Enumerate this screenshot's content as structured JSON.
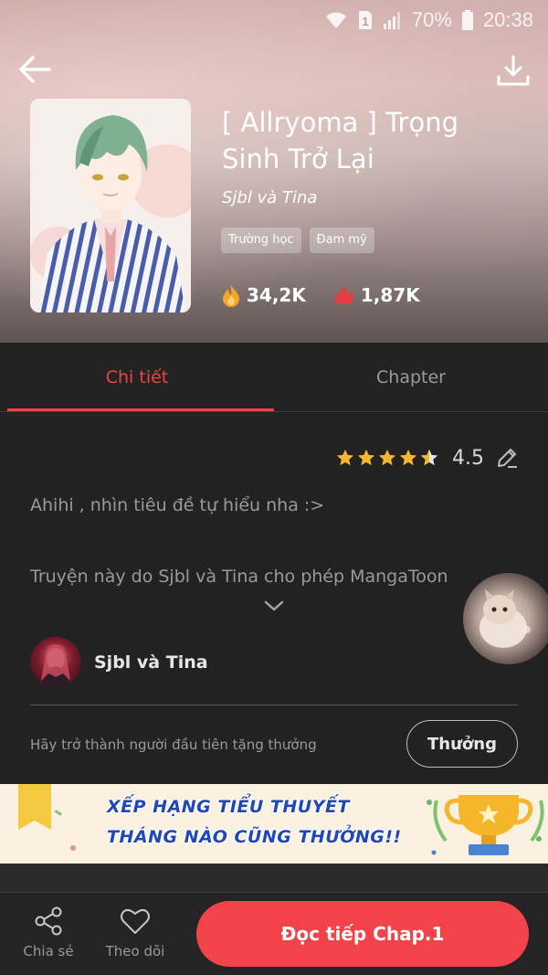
{
  "statusbar": {
    "battery": "70%",
    "time": "20:38",
    "sim": "1"
  },
  "header": {
    "title": "[ Allryoma ] Trọng Sinh Trở Lại",
    "author": "Sjbl và Tina",
    "tags": [
      "Trường học",
      "Đam mỹ"
    ],
    "views": "34,2K",
    "likes": "1,87K"
  },
  "tabs": {
    "details": "Chi tiết",
    "chapter": "Chapter"
  },
  "detail": {
    "rating": "4.5",
    "stars": 4.5,
    "description_line1": "Ahihi , nhìn tiêu đề tự hiểu nha :>",
    "description_line2": "Truyện này do Sjbl và Tina cho phép MangaToon",
    "author_name": "Sjbl và Tina",
    "reward_prompt": "Hãy trở thành người đầu tiên tặng thưởng",
    "reward_button": "Thưởng"
  },
  "banner": {
    "line1": "XẾP HẠNG TIỂU THUYẾT",
    "line2": "THÁNG NÀO CŨNG THƯỞNG!!"
  },
  "bottom_bar": {
    "share": "Chia sẻ",
    "follow": "Theo dõi",
    "read": "Đọc tiếp Chap.1"
  },
  "colors": {
    "accent": "#f0443f",
    "read_button": "#f2434a",
    "background": "#222222",
    "banner_text": "#1f47b8"
  },
  "icons": {
    "back": "arrow-left-icon",
    "download": "download-icon",
    "views": "flame-icon",
    "likes": "thumbs-up-icon",
    "edit": "pencil-icon",
    "expand": "chevron-down-icon",
    "share": "share-icon",
    "follow": "heart-icon"
  }
}
